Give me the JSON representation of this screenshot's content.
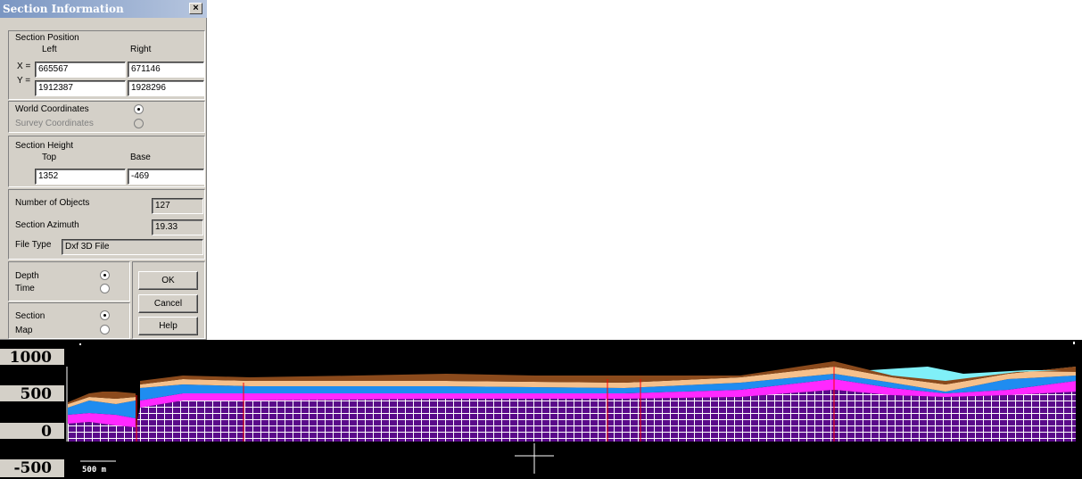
{
  "dialog": {
    "title": "Section Information",
    "close_label": "×",
    "section_position": {
      "label": "Section Position",
      "left_header": "Left",
      "right_header": "Right",
      "x_label": "X =",
      "y_label": "Y =",
      "x_left": "665567",
      "x_right": "671146",
      "y_left": "1912387",
      "y_right": "1928296"
    },
    "coordinates": {
      "world_label": "World Coordinates",
      "survey_label": "Survey Coordinates",
      "selected": "world"
    },
    "section_height": {
      "label": "Section Height",
      "top_header": "Top",
      "base_header": "Base",
      "top": "1352",
      "base": "-469"
    },
    "info": {
      "objects_label": "Number of Objects",
      "objects_value": "127",
      "azimuth_label": "Section Azimuth",
      "azimuth_value": "19.33",
      "file_type_label": "File Type",
      "file_type_value": "Dxf 3D File"
    },
    "domain_mode": {
      "depth_label": "Depth",
      "time_label": "Time",
      "selected": "depth"
    },
    "view_mode": {
      "section_label": "Section",
      "map_label": "Map",
      "selected": "section"
    },
    "buttons": {
      "ok": "OK",
      "cancel": "Cancel",
      "help": "Help"
    }
  },
  "section_view": {
    "y_ticks": [
      "1000",
      "500",
      "0",
      "-500"
    ],
    "scale_bar_label": "500 m",
    "colors": {
      "background": "#000000",
      "brown": "#8b4a1c",
      "peach": "#f5c08c",
      "blue": "#1f8cf0",
      "magenta": "#ff28ff",
      "basement": "#5a0a8a",
      "grid": "#ffffff",
      "cyan": "#80f0f8",
      "fault": "#ff0000"
    }
  }
}
